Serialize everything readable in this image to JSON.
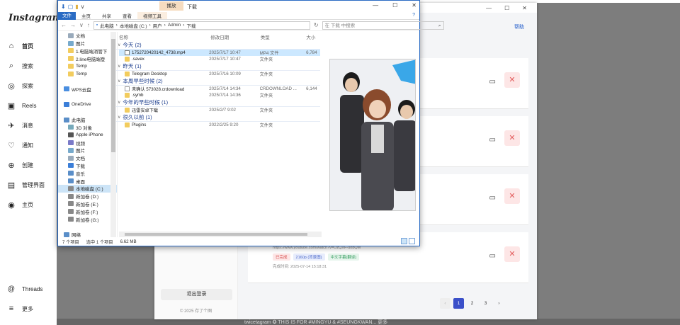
{
  "instagram": {
    "logo": "Instagram",
    "nav": [
      {
        "label": "首页",
        "icon": "home-icon",
        "glyph": "⌂"
      },
      {
        "label": "搜索",
        "icon": "search-icon",
        "glyph": "⌕"
      },
      {
        "label": "探索",
        "icon": "compass-icon",
        "glyph": "◎"
      },
      {
        "label": "Reels",
        "icon": "reels-icon",
        "glyph": "▣"
      },
      {
        "label": "消息",
        "icon": "messenger-icon",
        "glyph": "✈"
      },
      {
        "label": "通知",
        "icon": "heart-icon",
        "glyph": "♡"
      },
      {
        "label": "创建",
        "icon": "plus-icon",
        "glyph": "⊕"
      },
      {
        "label": "管理界面",
        "icon": "dashboard-icon",
        "glyph": "▤"
      },
      {
        "label": "主页",
        "icon": "profile-avatar-icon",
        "glyph": "◉"
      }
    ],
    "threads": "Threads",
    "more": "更多",
    "caption": "twicetagram ✪ THIS IS FOR #MINGYU & #SEUNGKWAN... 更多"
  },
  "manager": {
    "help": "帮助",
    "logout": "退出登录",
    "copyright": "© 2025 存了个图",
    "items": [
      {
        "show_meta": false
      },
      {
        "show_meta": false
      },
      {
        "show_meta": false
      },
      {
        "show_meta": true,
        "url": "https://www.youtube.com/watch?v=OzQXF-uobQM",
        "sub": "https://www.youtube.com/watch?v=OzQXF-uobQM",
        "tags": [
          {
            "label": "已完成",
            "color": "red"
          },
          {
            "label": "2160p (背景图)",
            "color": "blue"
          },
          {
            "label": "中文字幕(翻译)",
            "color": "green"
          }
        ],
        "done": "完成时间: 2025-07-14 15:18:31"
      }
    ],
    "pager": {
      "prev": "‹",
      "pages": [
        "1",
        "2",
        "3"
      ],
      "next": "›",
      "current": "1"
    }
  },
  "explorer": {
    "title": "下载",
    "tool_tab": "播放",
    "ribbon": {
      "file": "文件",
      "tabs": [
        "主页",
        "共享",
        "查看",
        "视频工具"
      ],
      "help_icon": "?"
    },
    "path": [
      "此电脑",
      "本地磁盘 (C:)",
      "用户",
      "Admin",
      "下载"
    ],
    "search_placeholder": "在 下载 中搜索",
    "nav": [
      {
        "label": "文档",
        "color": "#9ab"
      },
      {
        "label": "图片",
        "color": "#7ac"
      },
      {
        "label": "1.电脑端消管下",
        "color": "#f2cc5e"
      },
      {
        "label": "2.line电脑端登",
        "color": "#f2cc5e"
      },
      {
        "label": "Temp",
        "color": "#f2cc5e"
      },
      {
        "label": "Temp",
        "color": "#f2cc5e"
      },
      {
        "label": "",
        "color": "transparent"
      },
      {
        "label": "WPS云盘",
        "color": "#4a8ee0"
      },
      {
        "label": "",
        "color": "transparent"
      },
      {
        "label": "OneDrive",
        "color": "#3b7ed8"
      },
      {
        "label": "",
        "color": "transparent"
      },
      {
        "label": "此电脑",
        "color": "#5a8ec8"
      },
      {
        "label": "3D 对象",
        "color": "#7ab"
      },
      {
        "label": "Apple iPhone",
        "color": "#555"
      },
      {
        "label": "视频",
        "color": "#7a7ac8"
      },
      {
        "label": "图片",
        "color": "#7ac"
      },
      {
        "label": "文档",
        "color": "#9ab"
      },
      {
        "label": "下载",
        "color": "#3b7ed8"
      },
      {
        "label": "音乐",
        "color": "#5a8ec8"
      },
      {
        "label": "桌面",
        "color": "#5a8ec8"
      },
      {
        "label": "本地磁盘 (C:)",
        "color": "#888",
        "sel": true
      },
      {
        "label": "新加卷 (D:)",
        "color": "#888"
      },
      {
        "label": "新加卷 (E:)",
        "color": "#888"
      },
      {
        "label": "新加卷 (F:)",
        "color": "#888"
      },
      {
        "label": "新加卷 (G:)",
        "color": "#888"
      },
      {
        "label": "",
        "color": "transparent"
      },
      {
        "label": "网络",
        "color": "#5a8ec8"
      }
    ],
    "columns": [
      "名称",
      "修改日期",
      "类型",
      "大小"
    ],
    "groups": [
      {
        "name": "今天 (2)",
        "files": [
          {
            "name": "1752720420142_4738.mp4",
            "date": "2025/7/17 10:47",
            "type": "MP4 文件",
            "size": "6,784",
            "icon": "video",
            "sel": true
          },
          {
            "name": ".savex",
            "date": "2025/7/17 10:47",
            "type": "文件夹",
            "size": "",
            "icon": "folder"
          }
        ]
      },
      {
        "name": "昨天 (1)",
        "files": [
          {
            "name": "Telegram Desktop",
            "date": "2025/7/16 10:09",
            "type": "文件夹",
            "size": "",
            "icon": "folder"
          }
        ]
      },
      {
        "name": "本周早些时候 (2)",
        "files": [
          {
            "name": "未确认 573028.crdownload",
            "date": "2025/7/14 14:34",
            "type": "CRDOWNLOAD ...",
            "size": "6,144",
            "icon": "doc"
          },
          {
            "name": ".symb",
            "date": "2025/7/14 14:36",
            "type": "文件夹",
            "size": "",
            "icon": "folder"
          }
        ]
      },
      {
        "name": "今年的早些时候 (1)",
        "files": [
          {
            "name": "迅雷安卓下载",
            "date": "2025/2/7 9:02",
            "type": "文件夹",
            "size": "",
            "icon": "folder"
          }
        ]
      },
      {
        "name": "很久以前 (1)",
        "files": [
          {
            "name": "Plugins",
            "date": "2022/2/25 9:20",
            "type": "文件夹",
            "size": "",
            "icon": "folder"
          }
        ]
      }
    ],
    "status": {
      "count": "7 个项目",
      "selected": "选中 1 个项目",
      "size": "6.62 MB"
    }
  }
}
